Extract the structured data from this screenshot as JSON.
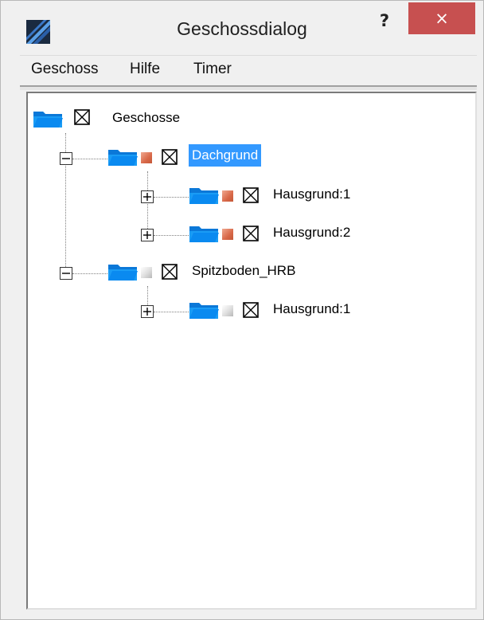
{
  "window": {
    "title": "Geschossdialog",
    "help_label": "?",
    "close_label": "×"
  },
  "menu": {
    "items": [
      "Geschoss",
      "Hilfe",
      "Timer"
    ]
  },
  "tree": {
    "root": {
      "label": "Geschosse",
      "icon": "folder-icon"
    },
    "nodes": [
      {
        "label": "Dachgrund",
        "selected": true,
        "expanded": true,
        "color": "#d86848",
        "children": [
          {
            "label": "Hausgrund:1",
            "expanded": false,
            "color": "#d86848"
          },
          {
            "label": "Hausgrund:2",
            "expanded": false,
            "color": "#d86848"
          }
        ]
      },
      {
        "label": "Spitzboden_HRB",
        "selected": false,
        "expanded": true,
        "color": "#dedede",
        "children": [
          {
            "label": "Hausgrund:1",
            "expanded": false,
            "color": "#dedede"
          }
        ]
      }
    ]
  },
  "colors": {
    "selection": "#3399ff",
    "close_button": "#c75050",
    "folder": "#0a8af0"
  }
}
